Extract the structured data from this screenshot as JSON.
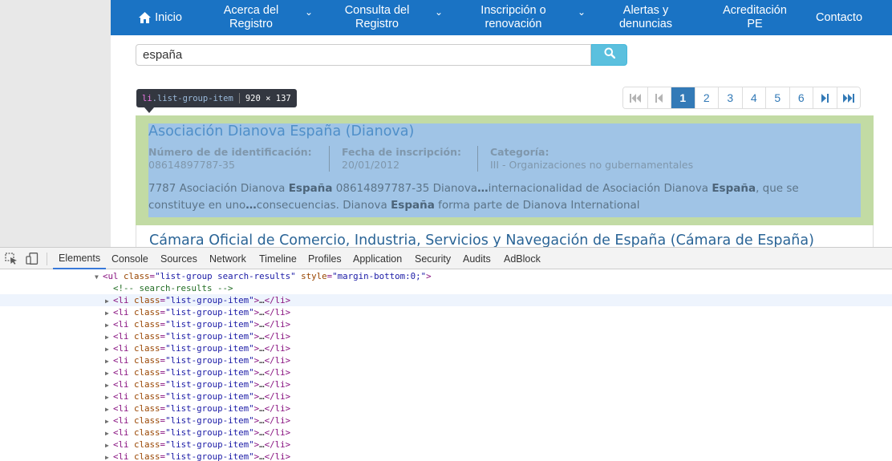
{
  "nav": {
    "home": "Inicio",
    "items": [
      {
        "line1": "Acerca del",
        "line2": "Registro",
        "has_caret": true
      },
      {
        "line1": "Consulta del",
        "line2": "Registro",
        "has_caret": true
      },
      {
        "line1": "Inscripción o",
        "line2": "renovación",
        "has_caret": true
      },
      {
        "line1": "Alertas y",
        "line2": "denuncias",
        "has_caret": false
      },
      {
        "line1": "Acreditación",
        "line2": "PE",
        "has_caret": false
      }
    ],
    "contact": "Contacto",
    "caret_glyph": "⌄"
  },
  "search": {
    "value": "españa",
    "button_icon": "search-icon"
  },
  "tooltip": {
    "tag": "li",
    "class_name": ".list-group-item",
    "dims": "920 × 137"
  },
  "pagination": {
    "pages": [
      "1",
      "2",
      "3",
      "4",
      "5",
      "6"
    ],
    "current": "1"
  },
  "result1": {
    "title": "Asociación Dianova España (Dianova)",
    "meta": [
      {
        "label": "Número de de identificación:",
        "value": "08614897787-35"
      },
      {
        "label": "Fecha de inscripción:",
        "value": "20/01/2012"
      },
      {
        "label": "Categoría:",
        "value": "III - Organizaciones no gubernamentales"
      }
    ],
    "snippet_line1_a": "7787 Asociación Dianova ",
    "snippet_bold1": "España",
    "snippet_line1_b": " 08614897787-35 Dianova",
    "snippet_ellipsis1": "…",
    "snippet_line1_c": "internacionalidad de Asociación Dianova ",
    "snippet_bold2": "España",
    "snippet_line1_d": ", que se",
    "snippet_line2_a": "constituye en uno",
    "snippet_ellipsis2": "…",
    "snippet_line2_b": "consecuencias. Dianova ",
    "snippet_bold3": "España",
    "snippet_line2_c": " forma parte de Dianova International"
  },
  "result2": {
    "title": "Cámara Oficial de Comercio, Industria, Servicios y Navegación de España (Cámara de España)"
  },
  "devtools": {
    "tabs": [
      "Elements",
      "Console",
      "Sources",
      "Network",
      "Timeline",
      "Profiles",
      "Application",
      "Security",
      "Audits",
      "AdBlock"
    ],
    "active_tab": "Elements",
    "ul_line": {
      "open": "<ul",
      "attr1": "class",
      "val1": "\"list-group search-results\"",
      "attr2": "style",
      "val2": "\"margin-bottom:0;\"",
      "close": ">"
    },
    "comment": "<!-- search-results -->",
    "li_row": {
      "open": "<li",
      "attr": "class",
      "val": "\"list-group-item\"",
      "mid": ">",
      "ellipsis": "…",
      "close": "</li>"
    },
    "li_count": 14
  },
  "colors": {
    "nav_bg": "#1a73c4",
    "highlight_margin": "#c2dba4",
    "highlight_content": "#a0c4e6",
    "active_page": "#337ab7",
    "search_button": "#5bc0de"
  }
}
